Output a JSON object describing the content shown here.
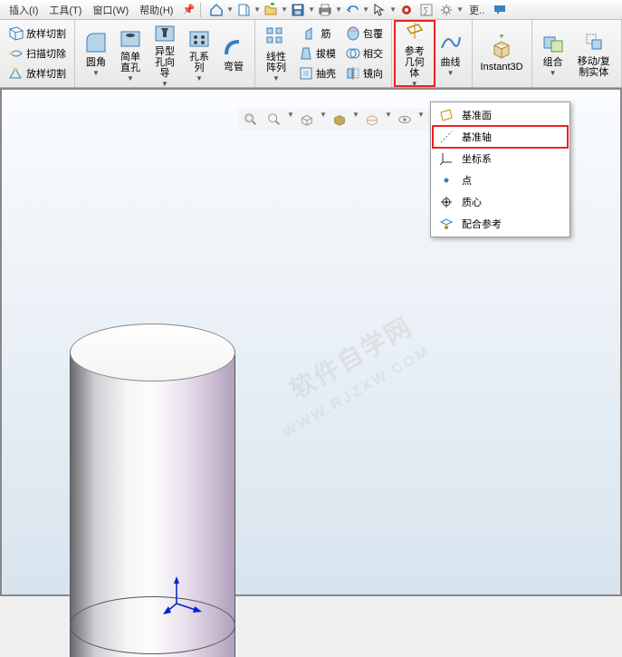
{
  "menu": {
    "insert": "插入(I)",
    "tools": "工具(T)",
    "window": "窗口(W)",
    "help": "帮助(H)"
  },
  "ribbon": {
    "loftCut": "放样切割",
    "sweepCut": "扫描切除",
    "loftCut2": "放样切割",
    "fillet": "圆角",
    "hole": "简单直孔",
    "shapeHole": "异型孔向导",
    "holeSeries": "孔系列",
    "bend": "弯管",
    "linearPattern": "线性阵列",
    "rib": "筋",
    "draft": "拔模",
    "shell": "抽壳",
    "wrap": "包覆",
    "intersect": "相交",
    "mirror": "镜向",
    "refGeom": "参考几何体",
    "curve": "曲线",
    "instant3d": "Instant3D",
    "combine": "组合",
    "moveCopy": "移动/复制实体"
  },
  "dropdown": {
    "plane": "基准面",
    "axis": "基准轴",
    "coord": "坐标系",
    "point": "点",
    "centroid": "质心",
    "mateRef": "配合参考"
  },
  "watermark": {
    "line1": "软件自学网",
    "line2": "WWW.RJZXW.COM"
  }
}
